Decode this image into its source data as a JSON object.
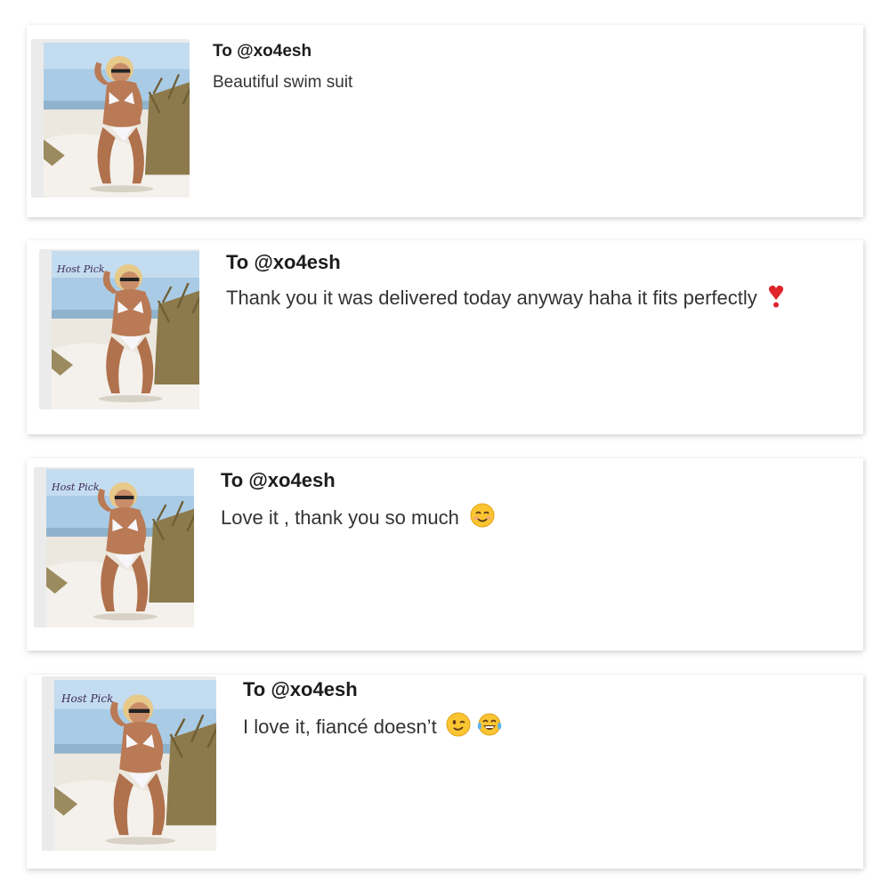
{
  "reviews": [
    {
      "recipient": "To @xo4esh",
      "message": "Beautiful swim suit",
      "photo_badge": "",
      "emojis": []
    },
    {
      "recipient": "To @xo4esh",
      "message": "Thank you it was delivered today anyway haha it fits perfectly",
      "photo_badge": "Host Pick",
      "emojis": [
        "exclamation-heart-emoji"
      ]
    },
    {
      "recipient": "To @xo4esh",
      "message": "Love it , thank you so much",
      "photo_badge": "Host Pick",
      "emojis": [
        "smiling-face-emoji"
      ]
    },
    {
      "recipient": "To @xo4esh",
      "message": "I love it, fiancé doesn’t",
      "photo_badge": "Host Pick",
      "emojis": [
        "winking-face-emoji",
        "tears-of-joy-emoji"
      ]
    }
  ],
  "colors": {
    "card_background": "#ffffff",
    "thumb_frame": "#ebebeb",
    "recipient_text": "#1c1c1c",
    "message_text": "#333333",
    "badge_text": "#3a2a5a"
  }
}
